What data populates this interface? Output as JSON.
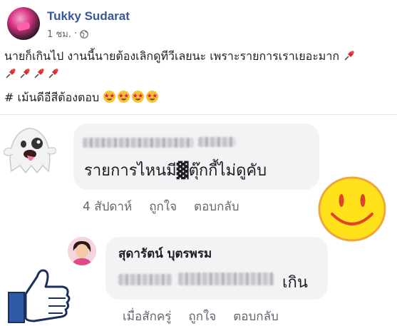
{
  "post": {
    "author": "Tukky Sudarat",
    "timestamp": "1 ชม.",
    "privacy_sep": "·",
    "line1": "นายก็เกินไป งานนี้นายต้องเลิกดูทีวีเลยนะ เพราะรายการเราเยอะมาก",
    "line3": "# เม้นดีอีสีต้องตอบ"
  },
  "comment1": {
    "text": "รายการไหนมี▓ตุ๊กกี้ไม่ดูคับ",
    "age": "4 สัปดาห์",
    "like": "ถูกใจ",
    "reply": "ตอบกลับ"
  },
  "comment2": {
    "name": "สุดารัตน์ บุตรพรม",
    "text_tail": "เกิน",
    "age": "เมื่อสักครู่",
    "like": "ถูกใจ",
    "reply": "ตอบกลับ"
  },
  "colors": {
    "author_link": "#365899",
    "bubble_bg": "#f2f3f5",
    "meta_text": "#616770",
    "smiley_yellow": "#ffe21a",
    "thumb_blue": "#2f5aa8"
  },
  "icons": [
    "globe-icon",
    "pushpin-icon",
    "star-struck-emoji",
    "ghost-emoji",
    "smiley-face-icon",
    "thumbs-up-icon"
  ]
}
